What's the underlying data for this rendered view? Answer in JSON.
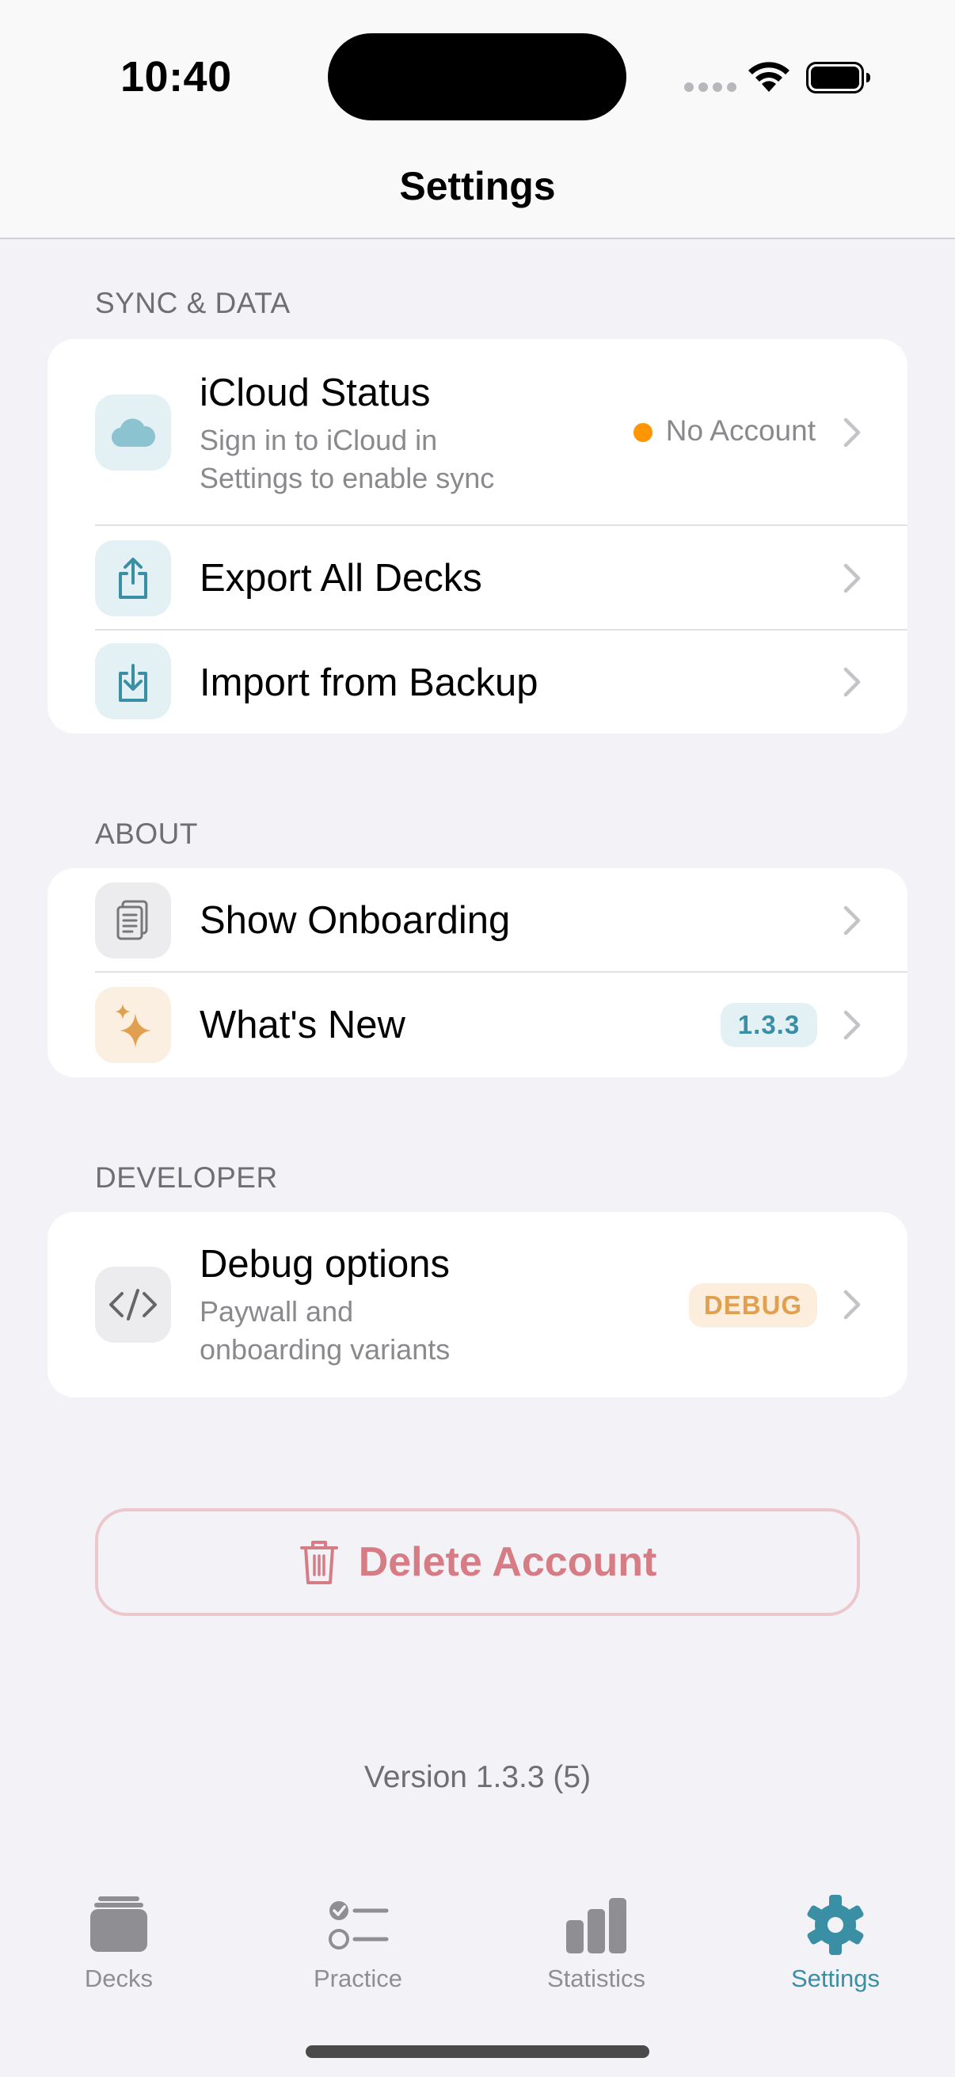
{
  "status_bar": {
    "time": "10:40"
  },
  "nav": {
    "title": "Settings"
  },
  "sections": {
    "sync": {
      "header": "SYNC & DATA",
      "icloud": {
        "title": "iCloud Status",
        "subtitle_line1": "Sign in to iCloud in",
        "subtitle_line2": "Settings to enable sync",
        "status": "No Account",
        "status_color": "#ff9500"
      },
      "export": {
        "title": "Export All Decks"
      },
      "import": {
        "title": "Import from Backup"
      }
    },
    "about": {
      "header": "ABOUT",
      "onboarding": {
        "title": "Show Onboarding"
      },
      "whats_new": {
        "title": "What's New",
        "badge": "1.3.3"
      }
    },
    "developer": {
      "header": "DEVELOPER",
      "debug": {
        "title": "Debug options",
        "subtitle_line1": "Paywall and",
        "subtitle_line2": "onboarding variants",
        "badge": "DEBUG"
      }
    }
  },
  "delete_account": {
    "label": "Delete Account",
    "color": "#d67c85"
  },
  "version": "Version 1.3.3 (5)",
  "tabbar": {
    "tabs": [
      {
        "label": "Decks",
        "icon": "cards-icon"
      },
      {
        "label": "Practice",
        "icon": "checklist-icon"
      },
      {
        "label": "Statistics",
        "icon": "bar-chart-icon"
      },
      {
        "label": "Settings",
        "icon": "gear-icon",
        "active": true
      }
    ],
    "accent": "#3a8fa5"
  }
}
